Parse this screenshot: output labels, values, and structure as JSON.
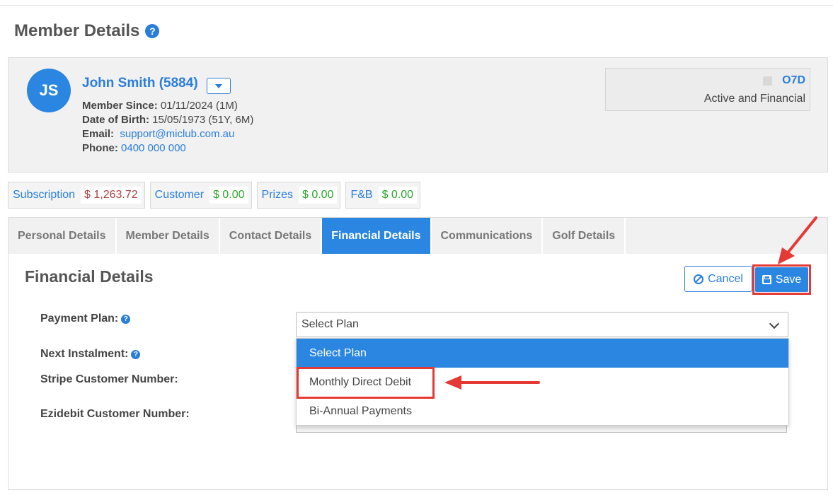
{
  "page": {
    "title": "Member Details"
  },
  "member": {
    "initials": "JS",
    "name": "John Smith (5884)",
    "since_label": "Member Since:",
    "since_value": "01/11/2024 (1M)",
    "dob_label": "Date of Birth:",
    "dob_value": "15/05/1973 (51Y, 6M)",
    "email_label": "Email:",
    "email_value": "support@miclub.com.au",
    "phone_label": "Phone:",
    "phone_value": "0400 000 000"
  },
  "status": {
    "code": "O7D",
    "text": "Active and Financial"
  },
  "balances": [
    {
      "label": "Subscription",
      "value": "$ 1,263.72"
    },
    {
      "label": "Customer",
      "value": "$ 0.00"
    },
    {
      "label": "Prizes",
      "value": "$ 0.00"
    },
    {
      "label": "F&B",
      "value": "$ 0.00"
    }
  ],
  "tabs": [
    {
      "label": "Personal Details"
    },
    {
      "label": "Member Details"
    },
    {
      "label": "Contact Details"
    },
    {
      "label": "Financial Details"
    },
    {
      "label": "Communications"
    },
    {
      "label": "Golf Details"
    }
  ],
  "financial": {
    "heading": "Financial Details",
    "cancel_label": "Cancel",
    "save_label": "Save",
    "payment_plan_label": "Payment Plan:",
    "next_instalment_label": "Next Instalment:",
    "stripe_label": "Stripe Customer Number:",
    "ezidebit_label": "Ezidebit Customer Number:",
    "select_value": "Select Plan",
    "options": [
      "Select Plan",
      "Monthly Direct Debit",
      "Bi-Annual Payments"
    ]
  },
  "colors": {
    "accent": "#2a86e0",
    "highlight": "#e53935",
    "positive": "#2aa72a",
    "negative": "#a94442"
  }
}
